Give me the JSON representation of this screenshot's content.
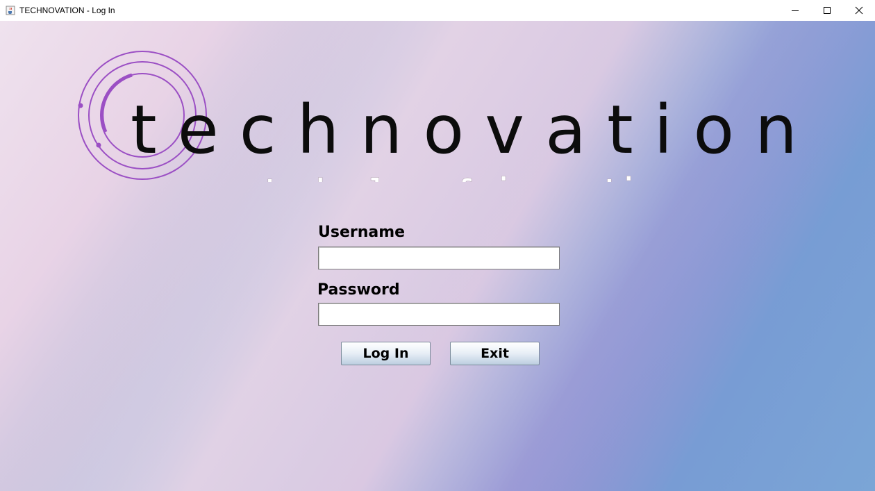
{
  "window": {
    "title": "TECHNOVATION - Log In",
    "icon": "java-cup-icon",
    "controls": [
      "minimize-icon",
      "maximize-icon",
      "close-icon"
    ]
  },
  "branding": {
    "wordmark": "technovation",
    "tagline": "technology & innovation",
    "logo_color": "#9b4fc4"
  },
  "form": {
    "username_label": "Username",
    "username_value": "",
    "password_label": "Password",
    "password_value": "",
    "login_button": "Log In",
    "exit_button": "Exit"
  },
  "colors": {
    "gradient_pink": "#e8d3e6",
    "gradient_blue": "#62a8d4",
    "gradient_purple": "#b04dc4"
  }
}
